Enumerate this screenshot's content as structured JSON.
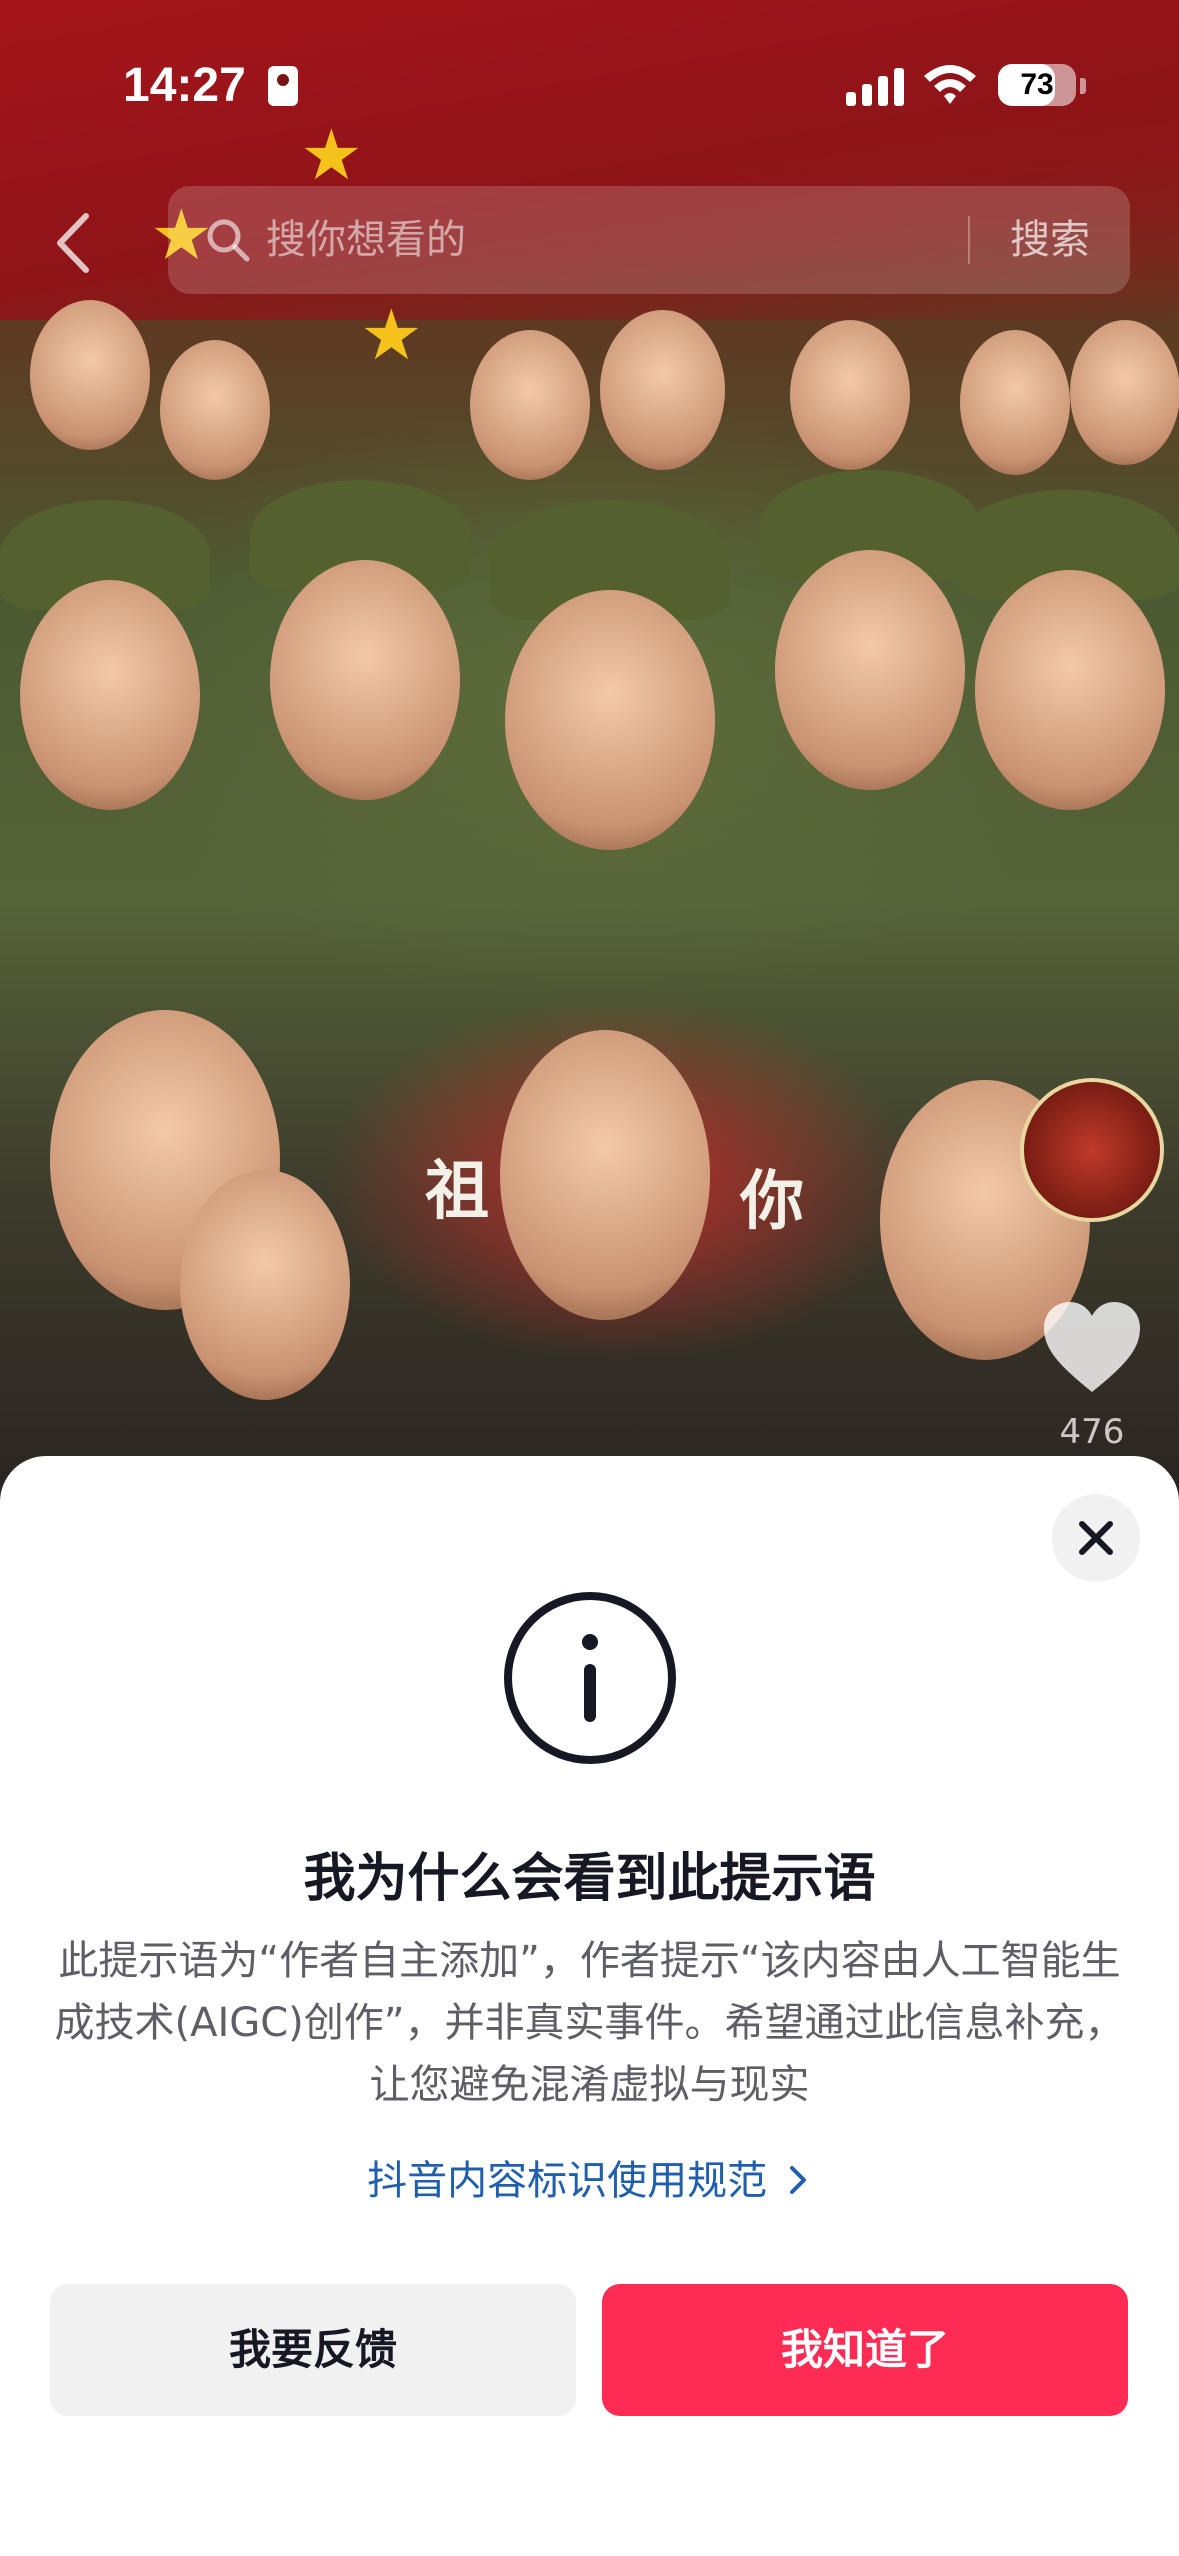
{
  "status_bar": {
    "time": "14:27",
    "battery_level": "73",
    "battery_fraction": 0.73,
    "icons": [
      "person-id-icon",
      "signal-icon",
      "wifi-icon",
      "battery-icon"
    ]
  },
  "search": {
    "placeholder": "搜你想看的",
    "button_label": "搜索",
    "icons": [
      "back-chevron-icon",
      "search-icon"
    ]
  },
  "video": {
    "overlay_text_left": "祖",
    "overlay_text_right": "你",
    "like_count": "476",
    "icons": [
      "creator-avatar",
      "heart-icon"
    ]
  },
  "sheet": {
    "title": "我为什么会看到此提示语",
    "body": "此提示语为“作者自主添加”，作者提示“该内容由人工智能生成技术(AIGC)创作”，并非真实事件。希望通过此信息补充，让您避免混淆虚拟与现实",
    "link_label": "抖音内容标识使用规范",
    "feedback_button": "我要反馈",
    "ok_button": "我知道了",
    "icons": [
      "close-icon",
      "info-icon",
      "chevron-right-icon"
    ]
  },
  "colors": {
    "primary": "#fe2c55",
    "link": "#1f5fae",
    "title": "#161823",
    "body": "#5e5f66"
  }
}
